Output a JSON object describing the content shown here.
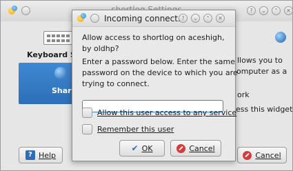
{
  "background_window": {
    "title": "shortlog Settings",
    "sidebar_title": "Keyboard S",
    "selected_item_label": "Shar",
    "text_lines": [
      "llows you to",
      "omputer as a",
      "ork",
      "ess this widget"
    ],
    "help_label": "Help",
    "cancel_label": "Cancel"
  },
  "dialog": {
    "title": "Incoming connect...",
    "message_line1": "Allow access to shortlog on aceshigh,",
    "message_line2": "by oldhp?",
    "instructions_line1": "Enter a password below. Enter the same",
    "instructions_line2": "password on the device to which you are",
    "instructions_line3": "trying to connect.",
    "password_value": "",
    "checkbox_allow_any_label": "Allow this user access to any service",
    "checkbox_remember_label": "Remember this user",
    "ok_label": "OK",
    "cancel_label": "Cancel",
    "titlebar_buttons": [
      "?",
      "⌄",
      "⌃",
      "✕"
    ]
  }
}
